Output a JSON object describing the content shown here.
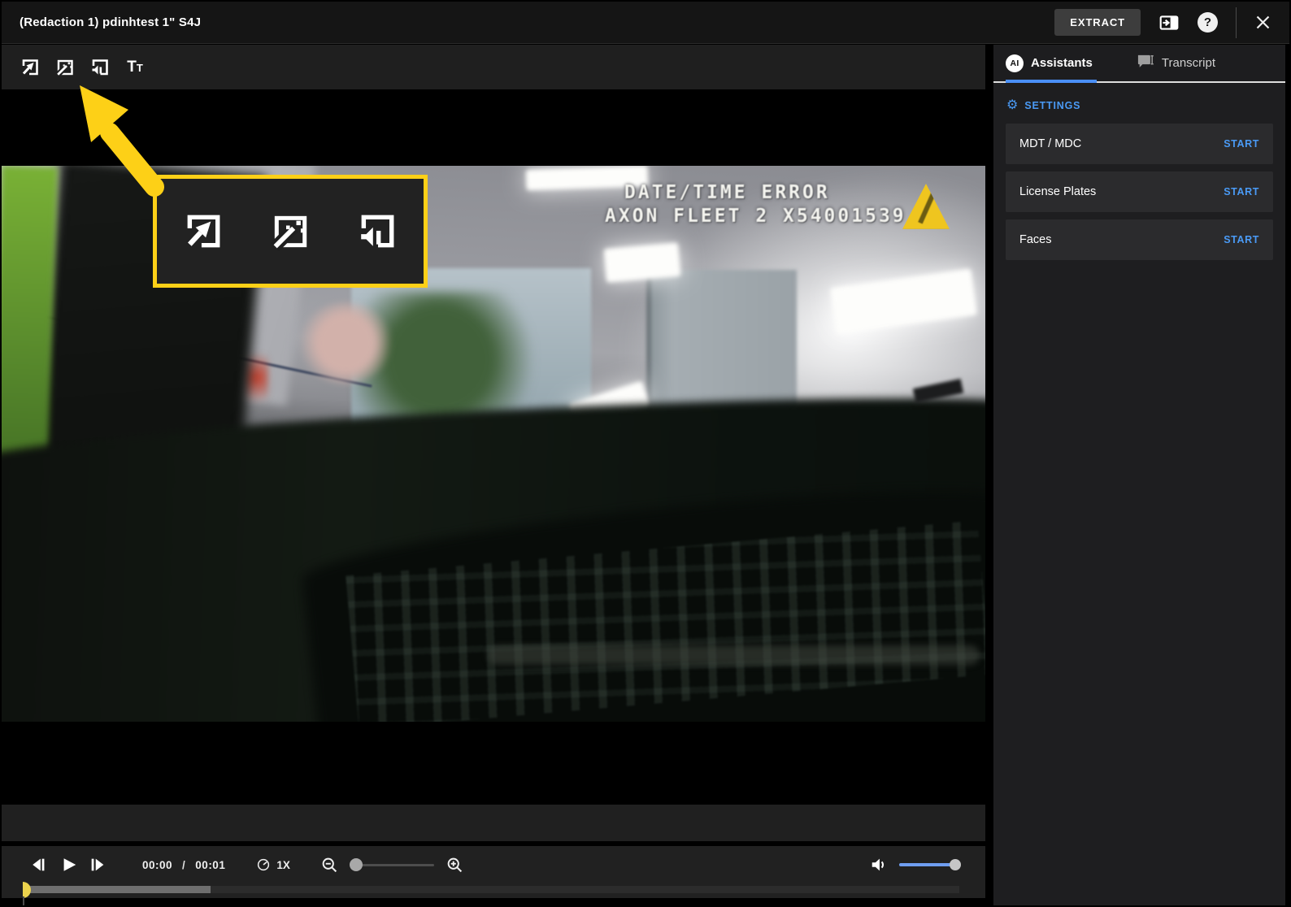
{
  "header": {
    "title": "(Redaction 1) pdinhtest 1\" S4J",
    "extract_label": "EXTRACT",
    "help_glyph": "?",
    "icons": [
      "panel-toggle-icon",
      "help-icon",
      "close-icon"
    ]
  },
  "toolbar": {
    "tools": [
      {
        "name": "box-redaction-tool",
        "icon": "cursor-box-icon"
      },
      {
        "name": "smart-wand-tool",
        "icon": "wand-box-icon"
      },
      {
        "name": "audio-redaction-tool",
        "icon": "audio-box-icon"
      },
      {
        "name": "text-tool",
        "icon": "text-tool-icon",
        "glyph_big": "T",
        "glyph_small": "T"
      }
    ]
  },
  "callout": {
    "border_color": "#fdd017",
    "highlighted_icons": [
      "cursor-box-icon",
      "wand-box-icon",
      "audio-box-icon"
    ],
    "arrow_color": "#fdd017"
  },
  "video": {
    "overlay_line1": "DATE/TIME ERROR",
    "overlay_line2": "AXON FLEET 2 X54001539",
    "logo": "axon-delta-logo"
  },
  "controls": {
    "current_time": "00:00",
    "time_separator": "/",
    "duration": "00:01",
    "speed": "1X",
    "zoom_level_percent": 0,
    "volume_percent": 100,
    "progress_percent": 0
  },
  "sidebar": {
    "ai_badge": "AI",
    "tabs": [
      {
        "label": "Assistants",
        "active": true
      },
      {
        "label": "Transcript",
        "active": false
      }
    ],
    "settings_label": "SETTINGS",
    "assistants": [
      {
        "name": "MDT / MDC",
        "action": "START"
      },
      {
        "name": "License Plates",
        "action": "START"
      },
      {
        "name": "Faces",
        "action": "START"
      }
    ]
  },
  "colors": {
    "accent_blue": "#4a9af5",
    "highlight_yellow": "#fdd017",
    "playhead_yellow": "#ecd34d",
    "axon_logo_yellow": "#efc51f"
  }
}
